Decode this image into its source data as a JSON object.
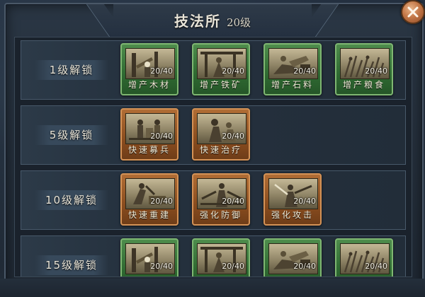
{
  "title": {
    "name": "技法所",
    "level": "20级"
  },
  "close_icon": "close-icon",
  "colors": {
    "unlocked": "#3f7c40",
    "locked": "#8a4d1f",
    "close": "#c47848"
  },
  "rows": [
    {
      "label": "1级解锁",
      "cards": [
        {
          "name": "增产木材",
          "count": "20/40",
          "style": "green",
          "icon": "lumber-icon"
        },
        {
          "name": "增产铁矿",
          "count": "20/40",
          "style": "green",
          "icon": "iron-ore-icon"
        },
        {
          "name": "增产石料",
          "count": "20/40",
          "style": "green",
          "icon": "stone-icon"
        },
        {
          "name": "增产粮食",
          "count": "20/40",
          "style": "green",
          "icon": "grain-icon"
        }
      ]
    },
    {
      "label": "5级解锁",
      "cards": [
        {
          "name": "快速募兵",
          "count": "20/40",
          "style": "orange",
          "icon": "recruit-icon"
        },
        {
          "name": "快速治疗",
          "count": "20/40",
          "style": "orange",
          "icon": "heal-icon"
        }
      ]
    },
    {
      "label": "10级解锁",
      "cards": [
        {
          "name": "快速重建",
          "count": "20/40",
          "style": "orange",
          "icon": "rebuild-icon"
        },
        {
          "name": "强化防御",
          "count": "20/40",
          "style": "orange",
          "icon": "defense-icon"
        },
        {
          "name": "强化攻击",
          "count": "20/40",
          "style": "orange",
          "icon": "attack-icon"
        }
      ]
    },
    {
      "label": "15级解锁",
      "cards": [
        {
          "name": "",
          "count": "20/40",
          "style": "green",
          "icon": "lumber-icon"
        },
        {
          "name": "",
          "count": "20/40",
          "style": "green",
          "icon": "iron-ore-icon"
        },
        {
          "name": "",
          "count": "20/40",
          "style": "green",
          "icon": "stone-icon"
        },
        {
          "name": "",
          "count": "20/40",
          "style": "green",
          "icon": "grain-icon"
        }
      ]
    }
  ]
}
